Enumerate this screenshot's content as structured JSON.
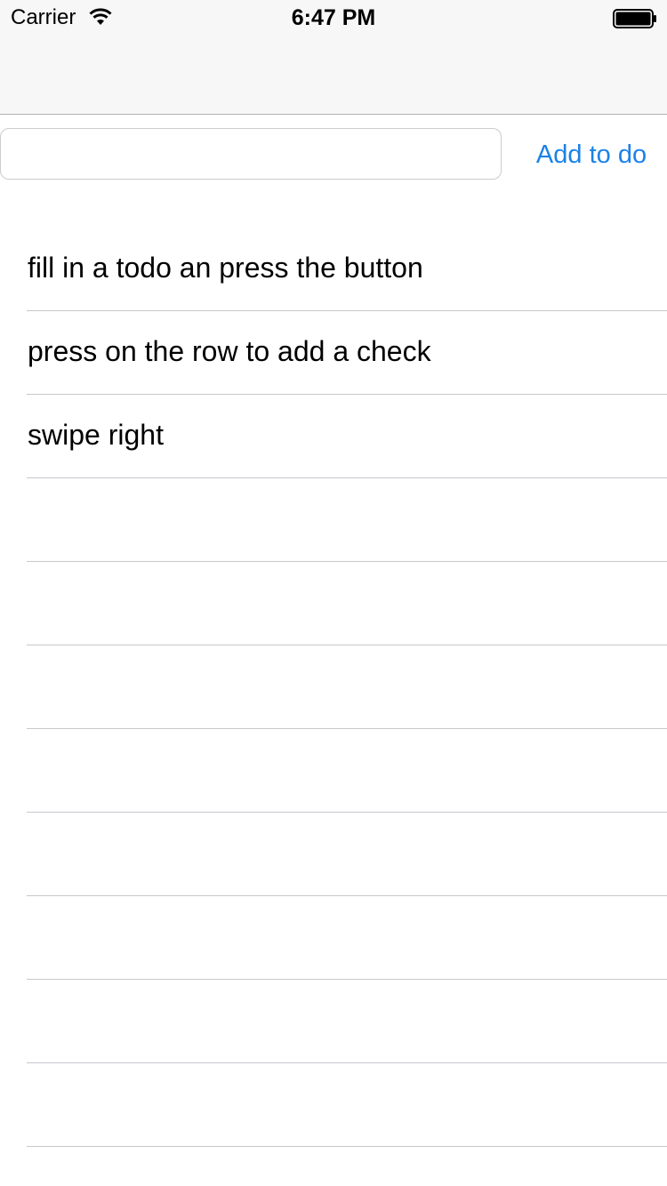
{
  "status_bar": {
    "carrier": "Carrier",
    "time": "6:47 PM",
    "wifi_icon": "wifi-icon",
    "battery_icon": "battery-icon"
  },
  "input_row": {
    "input_value": "",
    "input_placeholder": "",
    "add_button_label": "Add to do",
    "accent_color": "#1a82e8"
  },
  "todos": [
    {
      "label": "fill in a todo an press the button"
    },
    {
      "label": "press on the row to add a check"
    },
    {
      "label": "swipe right"
    },
    {
      "label": ""
    },
    {
      "label": ""
    },
    {
      "label": ""
    },
    {
      "label": ""
    },
    {
      "label": ""
    },
    {
      "label": ""
    },
    {
      "label": ""
    },
    {
      "label": ""
    }
  ]
}
